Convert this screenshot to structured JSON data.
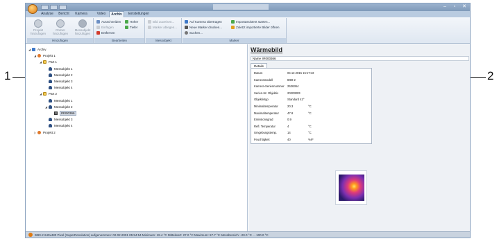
{
  "callouts": {
    "left": "1",
    "right": "2"
  },
  "ribbon_tabs": [
    "Analyse",
    "Bericht",
    "Kamera",
    "Video",
    "Archiv",
    "Einstellungen"
  ],
  "active_tab": "Archiv",
  "groups": {
    "hinzufuegen": {
      "label": "Hinzufügen",
      "buttons": [
        {
          "label": "Projekt hinzufügen",
          "icon": "project-icon"
        },
        {
          "label": "Ordner hinzufügen",
          "icon": "folder-icon"
        },
        {
          "label": "Messobjekt hinzufügen",
          "icon": "measurement-object-icon"
        }
      ]
    },
    "bearbeiten": {
      "label": "Bearbeiten",
      "items": [
        "Ausschneiden",
        "Einfügen",
        "Entfernen",
        "Höher",
        "Tiefer"
      ]
    },
    "messobjekt": {
      "label": "Messobjekt",
      "items": [
        "Bild zuweisen...",
        "Marker ablegen..."
      ]
    },
    "marker": {
      "label": "Marker",
      "items": [
        "Auf Kamera übertragen",
        "Neue Marker drucken...",
        "Suchen...",
        "Importassistent starten...",
        "Zuletzt importierte Bilder öffnen"
      ]
    }
  },
  "tree": [
    {
      "label": "Archiv",
      "level": 0,
      "icon": "archive",
      "twisty": "◢"
    },
    {
      "label": "Projekt 1",
      "level": 1,
      "icon": "project",
      "twisty": "◢"
    },
    {
      "label": "Part 1",
      "level": 2,
      "icon": "folder",
      "twisty": "◢"
    },
    {
      "label": "Messobjekt 1",
      "level": 3,
      "icon": "meas",
      "twisty": ""
    },
    {
      "label": "Messobjekt 2",
      "level": 3,
      "icon": "meas",
      "twisty": ""
    },
    {
      "label": "Messobjekt 3",
      "level": 3,
      "icon": "meas",
      "twisty": ""
    },
    {
      "label": "Messobjekt 4",
      "level": 3,
      "icon": "meas",
      "twisty": ""
    },
    {
      "label": "Part 2",
      "level": 2,
      "icon": "folder",
      "twisty": "◢"
    },
    {
      "label": "Messobjekt 1",
      "level": 3,
      "icon": "meas",
      "twisty": ""
    },
    {
      "label": "Messobjekt 2",
      "level": 3,
      "icon": "meas",
      "twisty": "◢"
    },
    {
      "label": "IR000366",
      "level": 4,
      "icon": "image",
      "twisty": "",
      "selected": true
    },
    {
      "label": "Messobjekt 3",
      "level": 3,
      "icon": "meas",
      "twisty": ""
    },
    {
      "label": "Messobjekt 4",
      "level": 3,
      "icon": "meas",
      "twisty": ""
    },
    {
      "label": "Projekt 2",
      "level": 1,
      "icon": "project",
      "twisty": "▷"
    }
  ],
  "properties": {
    "title": "Wärmebild",
    "name_label": "Name",
    "name_value": "IR000366",
    "details_tab": "Details",
    "rows": [
      {
        "key": "Datum",
        "value": "04.12.2015 15:17:42",
        "unit": ""
      },
      {
        "key": "Kameramodell",
        "value": "t890-2",
        "unit": ""
      },
      {
        "key": "Kamera-Seriennummer",
        "value": "2536364",
        "unit": ""
      },
      {
        "key": "Serien-Nr. Objektiv",
        "value": "20203003",
        "unit": ""
      },
      {
        "key": "Objektivtyp",
        "value": "Standard 42°",
        "unit": ""
      },
      {
        "key": "Minimaltemperatur",
        "value": "20.3",
        "unit": "°C"
      },
      {
        "key": "Maximaltemperatur",
        "value": "47.8",
        "unit": "°C"
      },
      {
        "key": "Emissionsgrad",
        "value": "0.9",
        "unit": ""
      },
      {
        "key": "Refl. Temperatur",
        "value": "4",
        "unit": "°C"
      },
      {
        "key": "Umgebungstemp.",
        "value": "14",
        "unit": "°C"
      },
      {
        "key": "Feuchtigkeit",
        "value": "40",
        "unit": "%rF"
      }
    ]
  },
  "status": {
    "text": "t890-2 640x480 Pixel (SuperResolution) aufgenommen: 02.02.2001 05:54:54 Minimum: 19.4 °C Mittelwert: 27.0 °C Maximum: 57.7 °C Messbereich: -20.0 °C ... 100.0 °C"
  },
  "colors": {
    "accent": "#3d78c8",
    "ribbon": "#dfe7f1",
    "titlebar": "#7f9ab9"
  }
}
